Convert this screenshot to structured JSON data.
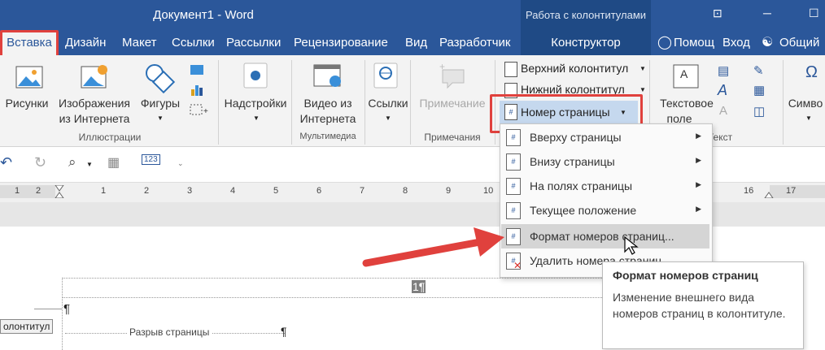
{
  "window": {
    "title": "Документ1 - Word",
    "context_group": "Работа с колонтитулами",
    "btn_ribbon": "⊡",
    "btn_minimize": "─",
    "btn_close": "☐"
  },
  "tabs": {
    "insert": "Вставка",
    "design": "Дизайн",
    "layout": "Макет",
    "links": "Ссылки",
    "mailings": "Рассылки",
    "review": "Рецензирование",
    "view": "Вид",
    "developer": "Разработчик",
    "constructor": "Конструктор",
    "help": "Помощ",
    "signin": "Вход",
    "share": "Общий"
  },
  "ribbon": {
    "pictures": "Рисунки",
    "online_pictures_1": "Изображения",
    "online_pictures_2": "из Интернета",
    "shapes": "Фигуры",
    "group_illustrations": "Иллюстрации",
    "addins": "Надстройки",
    "online_video_1": "Видео из",
    "online_video_2": "Интернета",
    "group_media": "Мультимедиа",
    "links": "Ссылки",
    "comment": "Примечание",
    "group_comments": "Примечания",
    "header": "Верхний колонтитул",
    "footer": "Нижний колонтитул",
    "page_number": "Номер страницы",
    "textbox_1": "Текстовое",
    "textbox_2": "поле",
    "group_text": "Текст",
    "symbols": "Симво"
  },
  "ruler": {
    "numbers": [
      "1",
      "2",
      "1",
      "1",
      "2",
      "3",
      "4",
      "5",
      "6",
      "7",
      "8",
      "9",
      "10",
      "16",
      "17"
    ]
  },
  "menu": {
    "items": [
      {
        "label": "Вверху страницы",
        "arrow": "▶"
      },
      {
        "label": "Внизу страницы",
        "arrow": "▶"
      },
      {
        "label": "На полях страницы",
        "arrow": "▶"
      },
      {
        "label": "Текущее положение",
        "arrow": "▶"
      },
      {
        "label": "Формат номеров страниц..."
      },
      {
        "label": "Удалить номера страниц"
      }
    ]
  },
  "tooltip": {
    "title": "Формат номеров страниц",
    "body": "Изменение внешнего вида номеров страниц в колонтитуле."
  },
  "document": {
    "page_number": "1¶",
    "pilcrow": "¶",
    "footer_tag": "олонтитул",
    "page_break": "Разрыв страницы",
    "page_break_mark": "¶"
  },
  "colors": {
    "word_blue": "#2b579a",
    "highlight_red": "#e0413d"
  }
}
